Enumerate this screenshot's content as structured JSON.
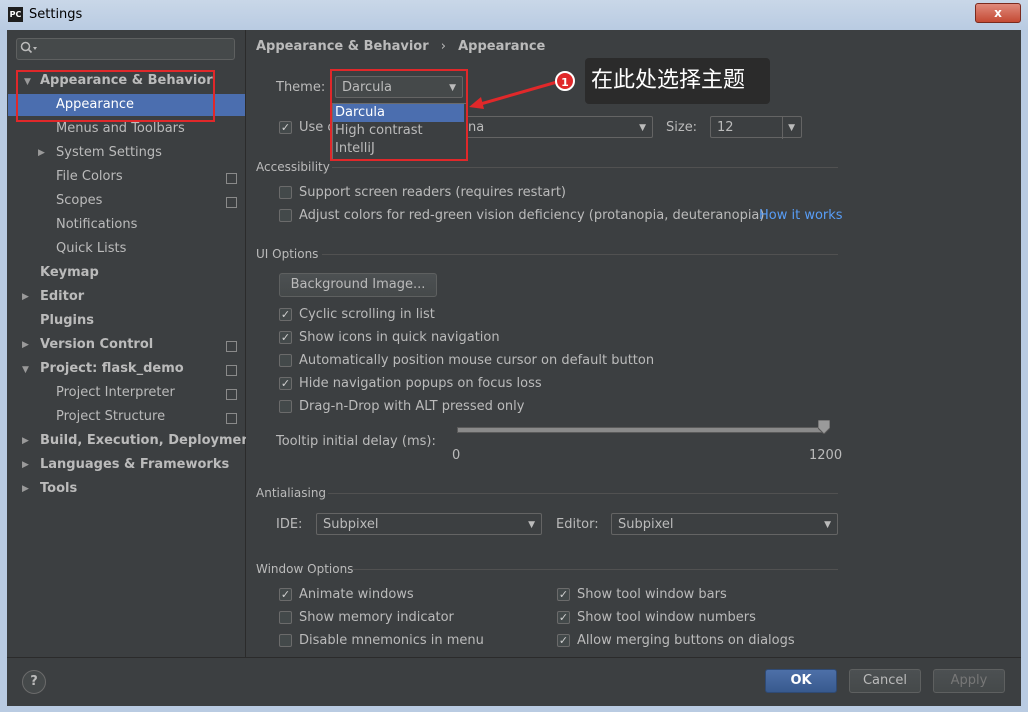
{
  "window": {
    "title": "Settings",
    "app_icon": "PC",
    "close_label": "x"
  },
  "search": {
    "placeholder": ""
  },
  "sidebar": {
    "items": [
      {
        "label": "Appearance & Behavior"
      },
      {
        "label": "Appearance"
      },
      {
        "label": "Menus and Toolbars"
      },
      {
        "label": "System Settings"
      },
      {
        "label": "File Colors"
      },
      {
        "label": "Scopes"
      },
      {
        "label": "Notifications"
      },
      {
        "label": "Quick Lists"
      },
      {
        "label": "Keymap"
      },
      {
        "label": "Editor"
      },
      {
        "label": "Plugins"
      },
      {
        "label": "Version Control"
      },
      {
        "label": "Project: flask_demo"
      },
      {
        "label": "Project Interpreter"
      },
      {
        "label": "Project Structure"
      },
      {
        "label": "Build, Execution, Deployment"
      },
      {
        "label": "Languages & Frameworks"
      },
      {
        "label": "Tools"
      }
    ]
  },
  "breadcrumb": {
    "parent": "Appearance & Behavior",
    "separator": "›",
    "current": "Appearance"
  },
  "theme": {
    "label": "Theme:",
    "value": "Darcula",
    "options": [
      "Darcula",
      "High contrast",
      "IntelliJ"
    ]
  },
  "font": {
    "use_label_prefix": "Use c",
    "value_suffix": "na",
    "size_label": "Size:",
    "size_value": "12"
  },
  "annotation": {
    "badge": "1",
    "text": "在此处选择主题"
  },
  "accessibility": {
    "title": "Accessibility",
    "screen_readers": "Support screen readers (requires restart)",
    "color_adjust": "Adjust colors for red-green vision deficiency (protanopia, deuteranopia)",
    "how_it_works": "How it works"
  },
  "ui_options": {
    "title": "UI Options",
    "background_image": "Background Image...",
    "cyclic_scrolling": "Cyclic scrolling in list",
    "show_icons": "Show icons in quick navigation",
    "auto_position": "Automatically position mouse cursor on default button",
    "hide_popups": "Hide navigation popups on focus loss",
    "drag_drop": "Drag-n-Drop with ALT pressed only",
    "tooltip_label": "Tooltip initial delay (ms):",
    "slider_min": "0",
    "slider_max": "1200",
    "slider_value_fraction": 1.0
  },
  "antialiasing": {
    "title": "Antialiasing",
    "ide_label": "IDE:",
    "ide_value": "Subpixel",
    "editor_label": "Editor:",
    "editor_value": "Subpixel"
  },
  "window_options": {
    "title": "Window Options",
    "animate": "Animate windows",
    "memory": "Show memory indicator",
    "mnemonics": "Disable mnemonics in menu",
    "tool_bars": "Show tool window bars",
    "tool_numbers": "Show tool window numbers",
    "merging": "Allow merging buttons on dialogs"
  },
  "footer": {
    "help": "?",
    "ok": "OK",
    "cancel": "Cancel",
    "apply": "Apply"
  },
  "colors": {
    "accent": "#4b6eaf",
    "annotation_red": "#e0282a",
    "link": "#589df6",
    "background": "#3c3f41"
  }
}
